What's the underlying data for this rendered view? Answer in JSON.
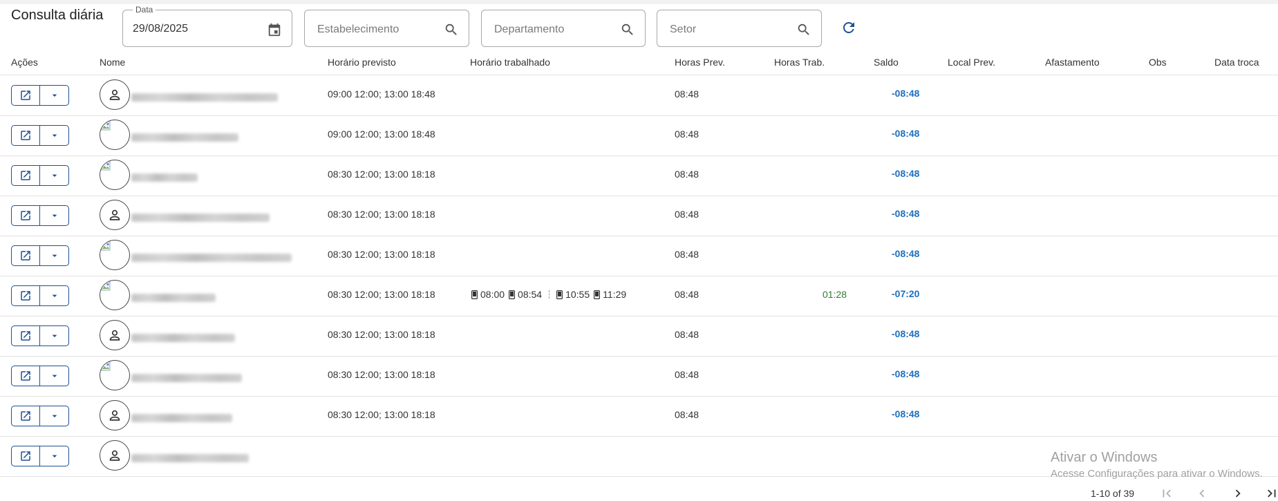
{
  "page": {
    "title": "Consulta diária"
  },
  "filters": {
    "date": {
      "label": "Data",
      "value": "29/08/2025"
    },
    "estabelecimento": {
      "placeholder": "Estabelecimento"
    },
    "departamento": {
      "placeholder": "Departamento"
    },
    "setor": {
      "placeholder": "Setor"
    }
  },
  "table": {
    "columns": {
      "acoes": "Ações",
      "nome": "Nome",
      "horario_previsto": "Horário previsto",
      "horario_trabalhado": "Horário trabalhado",
      "horas_prev": "Horas Prev.",
      "horas_trab": "Horas Trab.",
      "saldo": "Saldo",
      "local_prev": "Local Prev.",
      "afastamento": "Afastamento",
      "obs": "Obs",
      "data_troca": "Data troca"
    },
    "rows": [
      {
        "horario_previsto": "09:00 12:00; 13:00 18:48",
        "horas_prev": "08:48",
        "horas_trab": "",
        "saldo": "-08:48",
        "avatar": "person-icon"
      },
      {
        "horario_previsto": "09:00 12:00; 13:00 18:48",
        "horas_prev": "08:48",
        "horas_trab": "",
        "saldo": "-08:48",
        "avatar": "broken-image-icon"
      },
      {
        "horario_previsto": "08:30 12:00; 13:00 18:18",
        "horas_prev": "08:48",
        "horas_trab": "",
        "saldo": "-08:48",
        "avatar": "broken-image-icon"
      },
      {
        "horario_previsto": "08:30 12:00; 13:00 18:18",
        "horas_prev": "08:48",
        "horas_trab": "",
        "saldo": "-08:48",
        "avatar": "person-icon"
      },
      {
        "horario_previsto": "08:30 12:00; 13:00 18:18",
        "horas_prev": "08:48",
        "horas_trab": "",
        "saldo": "-08:48",
        "avatar": "broken-image-icon"
      },
      {
        "horario_previsto": "08:30 12:00; 13:00 18:18",
        "horas_prev": "08:48",
        "horas_trab": "01:28",
        "saldo": "-07:20",
        "avatar": "broken-image-icon",
        "punches": [
          {
            "time": "08:00"
          },
          {
            "time": "08:54"
          },
          {
            "time": "10:55"
          },
          {
            "time": "11:29"
          }
        ]
      },
      {
        "horario_previsto": "08:30 12:00; 13:00 18:18",
        "horas_prev": "08:48",
        "horas_trab": "",
        "saldo": "-08:48",
        "avatar": "person-icon"
      },
      {
        "horario_previsto": "08:30 12:00; 13:00 18:18",
        "horas_prev": "08:48",
        "horas_trab": "",
        "saldo": "-08:48",
        "avatar": "broken-image-icon"
      },
      {
        "horario_previsto": "08:30 12:00; 13:00 18:18",
        "horas_prev": "08:48",
        "horas_trab": "",
        "saldo": "-08:48",
        "avatar": "person-icon"
      },
      {
        "horario_previsto": "",
        "horas_prev": "",
        "horas_trab": "",
        "saldo": "",
        "avatar": "person-icon"
      }
    ]
  },
  "watermark": {
    "line1": "Ativar o Windows",
    "line2": "Acesse Configurações para ativar o Windows."
  },
  "pagination": {
    "range": "1-10 of 39"
  },
  "colors": {
    "accent": "#1d4f91",
    "saldo": "#1d6fc0",
    "worked": "#2e7d32"
  }
}
